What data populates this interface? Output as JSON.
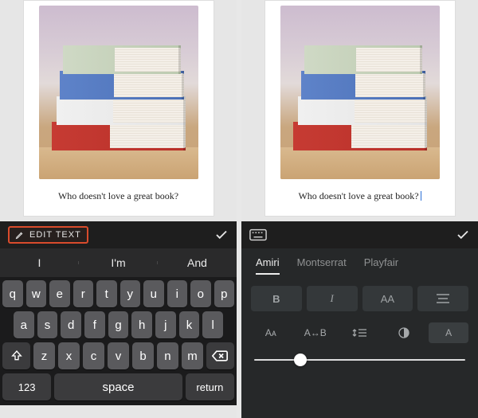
{
  "caption": "Who doesn't love a great book?",
  "left": {
    "editLabel": "EDIT TEXT",
    "suggestions": [
      "I",
      "I'm",
      "And"
    ],
    "keyboard": {
      "row1": [
        "q",
        "w",
        "e",
        "r",
        "t",
        "y",
        "u",
        "i",
        "o",
        "p"
      ],
      "row2": [
        "a",
        "s",
        "d",
        "f",
        "g",
        "h",
        "j",
        "k",
        "l"
      ],
      "row3": [
        "z",
        "x",
        "c",
        "v",
        "b",
        "n",
        "m"
      ],
      "numKey": "123",
      "spaceKey": "space",
      "returnKey": "return"
    }
  },
  "right": {
    "fonts": [
      {
        "name": "Amiri",
        "active": true
      },
      {
        "name": "Montserrat",
        "active": false
      },
      {
        "name": "Playfair",
        "active": false
      }
    ],
    "styleRow": {
      "bold": "B",
      "italic": "I",
      "caps": "AA"
    },
    "toolRow": {
      "size": "Aᴀ",
      "spacing": "A↔B",
      "line": "↕≡",
      "contrast": "◐",
      "box": "A"
    },
    "sliderPercent": 22
  },
  "books": [
    {
      "color": "red"
    },
    {
      "color": "white"
    },
    {
      "color": "blue"
    },
    {
      "color": "sage"
    }
  ]
}
